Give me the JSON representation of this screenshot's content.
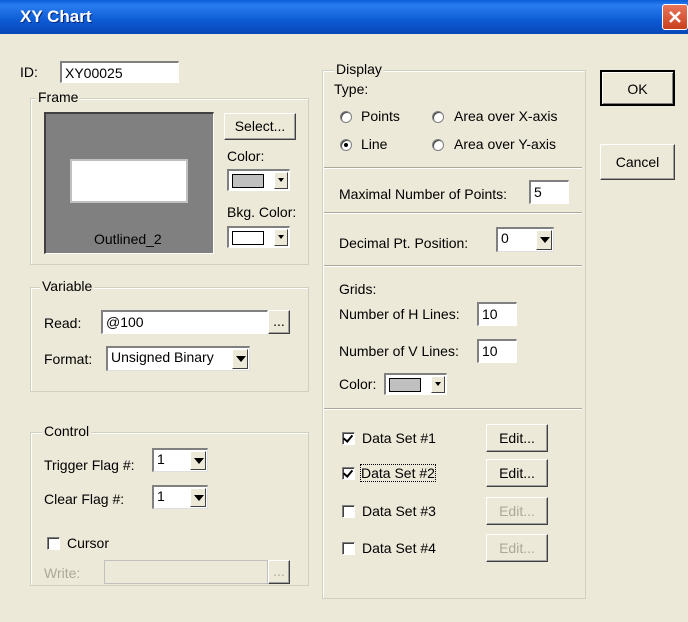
{
  "window": {
    "title": "XY Chart"
  },
  "id": {
    "label": "ID:",
    "value": "XY00025"
  },
  "frame": {
    "title": "Frame",
    "preview_label": "Outlined_2",
    "select_label": "Select...",
    "color_label": "Color:",
    "bkg_color_label": "Bkg. Color:",
    "color_value": "#C0C0C0",
    "bkg_color_value": "#FFFFFF"
  },
  "variable": {
    "title": "Variable",
    "read_label": "Read:",
    "read_value": "@100",
    "browse_label": "...",
    "format_label": "Format:",
    "format_value": "Unsigned Binary"
  },
  "control": {
    "title": "Control",
    "trigger_label": "Trigger Flag #:",
    "trigger_value": "1",
    "clear_label": "Clear Flag #:",
    "clear_value": "1",
    "cursor_label": "Cursor",
    "write_label": "Write:",
    "write_value": "",
    "browse_label": "..."
  },
  "display": {
    "title": "Display",
    "type_label": "Type:",
    "types": [
      "Points",
      "Area over X-axis",
      "Line",
      "Area over Y-axis"
    ],
    "selected_type": "Line",
    "max_points_label": "Maximal Number of Points:",
    "max_points_value": "5",
    "decimal_label": "Decimal Pt. Position:",
    "decimal_value": "0",
    "grids_label": "Grids:",
    "h_lines_label": "Number of H Lines:",
    "h_lines_value": "10",
    "v_lines_label": "Number of V Lines:",
    "v_lines_value": "10",
    "grid_color_label": "Color:",
    "grid_color_value": "#C0C0C0",
    "data_sets": [
      {
        "label": "Data Set #1",
        "checked": true,
        "edit": "Edit...",
        "enabled": true
      },
      {
        "label": "Data Set #2",
        "checked": true,
        "edit": "Edit...",
        "enabled": true
      },
      {
        "label": "Data Set #3",
        "checked": false,
        "edit": "Edit...",
        "enabled": false
      },
      {
        "label": "Data Set #4",
        "checked": false,
        "edit": "Edit...",
        "enabled": false
      }
    ]
  },
  "buttons": {
    "ok": "OK",
    "cancel": "Cancel"
  }
}
